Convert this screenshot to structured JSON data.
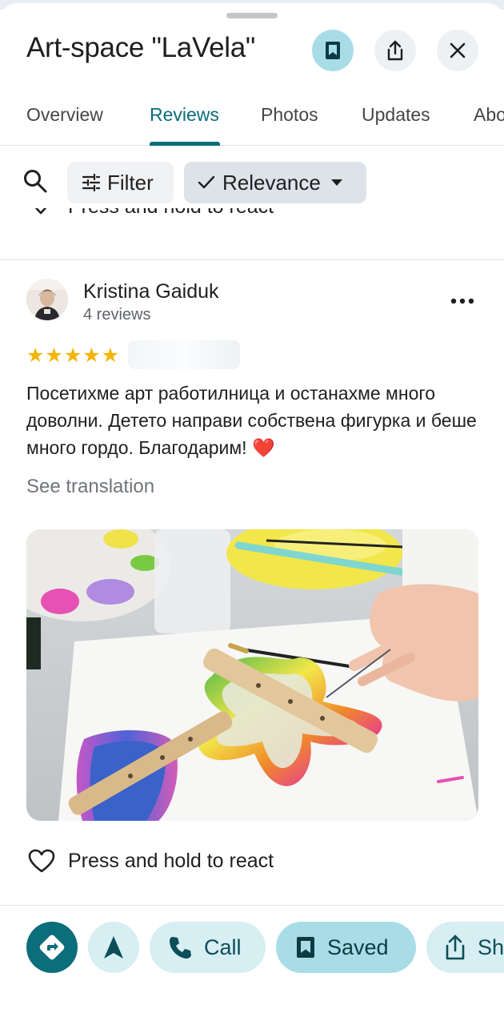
{
  "header": {
    "title": "Art-space \"LaVela\"",
    "save_icon": "bookmark-filled-icon",
    "share_icon": "share-icon",
    "close_icon": "close-icon"
  },
  "tabs": [
    {
      "label": "Overview",
      "active": false
    },
    {
      "label": "Reviews",
      "active": true
    },
    {
      "label": "Photos",
      "active": false
    },
    {
      "label": "Updates",
      "active": false
    },
    {
      "label": "Abo",
      "active": false
    }
  ],
  "filters": {
    "filter_label": "Filter",
    "relevance_label": "Relevance"
  },
  "previous_review": {
    "react_label": "Press and hold to react"
  },
  "review": {
    "author": "Kristina Gaiduk",
    "reviews_count": "4 reviews",
    "rating": 5,
    "stars": "★★★★★",
    "text": "Посетихме арт работилница и останахме много доволни. Детето направи собствена фигурка и беше много гордо. Благодарим!",
    "emoji": "❤️",
    "translate_label": "See translation",
    "react_label": "Press and hold to react"
  },
  "bottom_bar": {
    "call_label": "Call",
    "saved_label": "Saved",
    "share_label": "Sh"
  },
  "colors": {
    "accent": "#0b6e7a",
    "accent_light": "#d7eef3",
    "saved_bg": "#a8dde8",
    "star": "#f4b400"
  }
}
